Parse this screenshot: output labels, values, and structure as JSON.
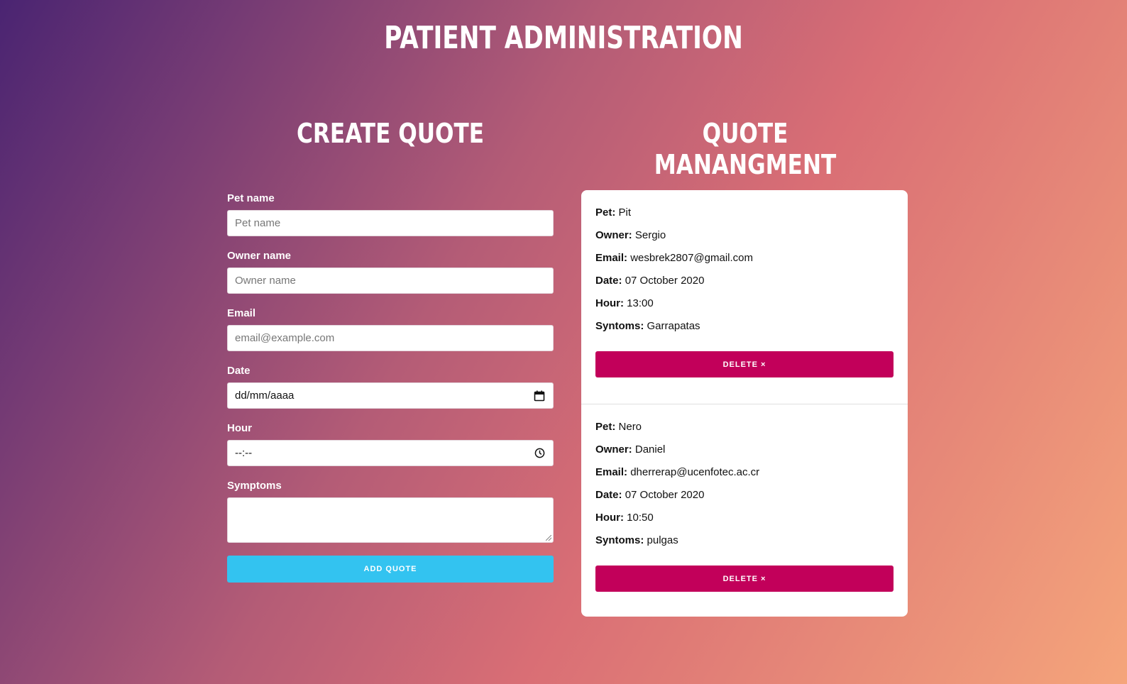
{
  "header": {
    "title": "PATIENT ADMINISTRATION"
  },
  "create": {
    "title": "CREATE QUOTE",
    "fields": {
      "pet": {
        "label": "Pet name",
        "placeholder": "Pet name"
      },
      "owner": {
        "label": "Owner name",
        "placeholder": "Owner name"
      },
      "email": {
        "label": "Email",
        "placeholder": "email@example.com"
      },
      "date": {
        "label": "Date",
        "value": "dd/mm/aaaa"
      },
      "hour": {
        "label": "Hour",
        "value": "--:--"
      },
      "symptoms": {
        "label": "Symptoms",
        "value": ""
      }
    },
    "submit_label": "ADD QUOTE",
    "accent_color": "#33c3f0"
  },
  "manage": {
    "title": "QUOTE MANANGMENT",
    "labels": {
      "pet": "Pet:",
      "owner": "Owner:",
      "email": "Email:",
      "date": "Date:",
      "hour": "Hour:",
      "symptoms": "Syntoms:"
    },
    "delete_label": "DELETE ×",
    "delete_color": "#c2005a",
    "quotes": [
      {
        "pet": "Pit",
        "owner": "Sergio",
        "email": "wesbrek2807@gmail.com",
        "date": "07 October 2020",
        "hour": "13:00",
        "symptoms": "Garrapatas"
      },
      {
        "pet": "Nero",
        "owner": "Daniel",
        "email": "dherrerap@ucenfotec.ac.cr",
        "date": "07 October 2020",
        "hour": "10:50",
        "symptoms": "pulgas"
      }
    ]
  }
}
